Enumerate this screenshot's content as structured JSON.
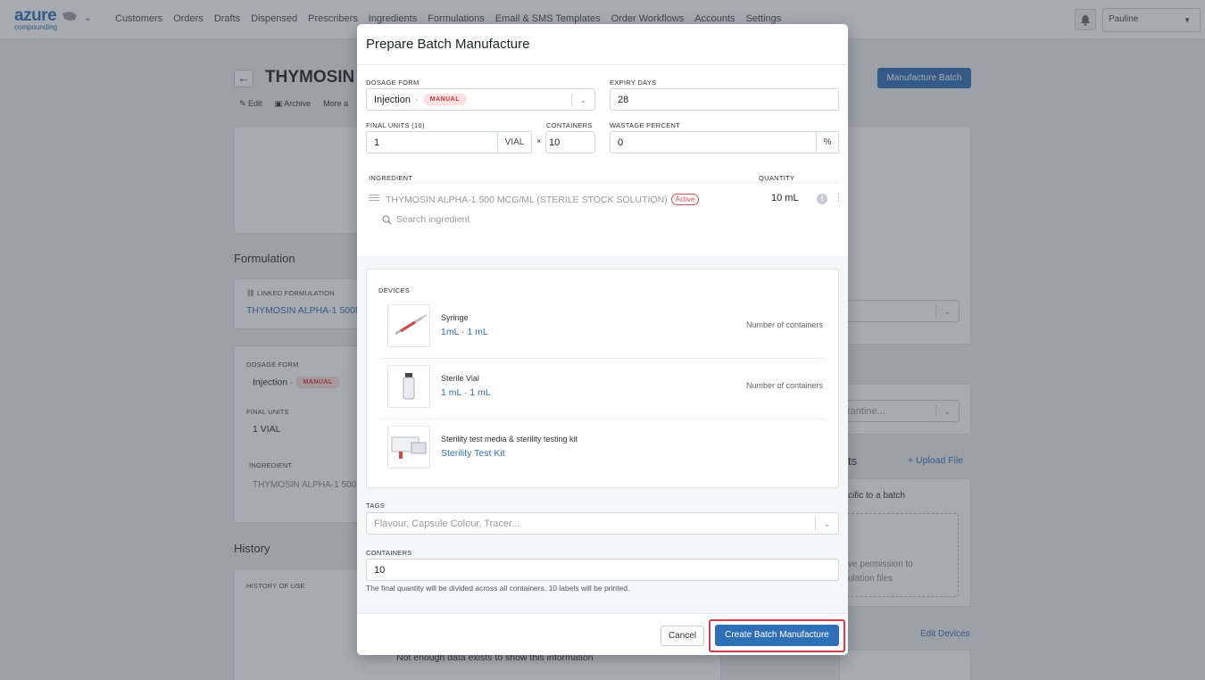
{
  "nav": {
    "brand_main": "azure",
    "brand_sub": "compounding",
    "links": [
      "Customers",
      "Orders",
      "Drafts",
      "Dispensed",
      "Prescribers",
      "Ingredients",
      "Formulations",
      "Email & SMS Templates",
      "Order Workflows",
      "Accounts",
      "Settings"
    ],
    "user": "Pauline"
  },
  "background": {
    "title": "THYMOSIN",
    "actions": {
      "edit": "Edit",
      "archive": "Archive",
      "more": "More a"
    },
    "manufacture_button": "Manufacture Batch",
    "formulation_heading": "Formulation",
    "linked_formulation_label": "LINKED FORMULATION",
    "linked_formulation_value": "THYMOSIN ALPHA-1 500M",
    "dosage_form_label": "DOSAGE FORM",
    "dosage_form_value": "Injection",
    "manual_badge": "MANUAL",
    "final_units_label": "FINAL UNITS",
    "final_units_value": "1 VIAL",
    "ingredient_label": "INGREDIENT",
    "ingredient_value": "THYMOSIN ALPHA-1 500",
    "history_heading": "History",
    "history_of_use_label": "HISTORY OF USE",
    "no_data_text": "Not enough data exists to show this information",
    "right_docs_suffix": "ts",
    "upload_file": "+ Upload File",
    "specific_batch": "cific to a batch",
    "permission_line1": "ve permission to",
    "permission_line2": "ulation files",
    "quarantine_placeholder": "rantine...",
    "edit_devices": "Edit Devices"
  },
  "modal": {
    "title": "Prepare Batch Manufacture",
    "dosage_form_label": "DOSAGE FORM",
    "dosage_form_value": "Injection",
    "manual_badge": "MANUAL",
    "expiry_days_label": "EXPIRY DAYS",
    "expiry_days_value": "28",
    "final_units_label": "FINAL UNITS (10)",
    "final_units_value": "1",
    "final_units_unit": "VIAL",
    "times_symbol": "×",
    "containers_label": "CONTAINERS",
    "containers_value": "10",
    "wastage_label": "WASTAGE PERCENT",
    "wastage_value": "0",
    "wastage_unit": "%",
    "ingredient_header": "INGREDIENT",
    "quantity_header": "QUANTITY",
    "ingredient": {
      "name": "THYMOSIN ALPHA-1 500 MCG/ML (STERILE STOCK SOLUTION)",
      "status": "Active",
      "quantity": "10 mL"
    },
    "search_placeholder": "Search ingredient",
    "devices_label": "DEVICES",
    "devices": [
      {
        "name": "Syringe",
        "sub": "1mL · 1 mL",
        "right": "Number of containers"
      },
      {
        "name": "Sterile Vial",
        "sub": "1 mL · 1 mL",
        "right": "Number of containers"
      },
      {
        "name": "Sterility test media & sterility testing kit",
        "sub": "Sterility Test Kit",
        "right": ""
      }
    ],
    "tags_label": "TAGS",
    "tags_placeholder": "Flavour, Capsule Colour, Tracer...",
    "containers2_label": "CONTAINERS",
    "containers2_value": "10",
    "hint": "The final quantity will be divided across all containers. 10 labels will be printed.",
    "cancel": "Cancel",
    "create": "Create Batch Manufacture"
  },
  "colors": {
    "accent": "#2f6fb7",
    "highlight": "#d33a4a",
    "manual_bg": "#fde1e1"
  }
}
